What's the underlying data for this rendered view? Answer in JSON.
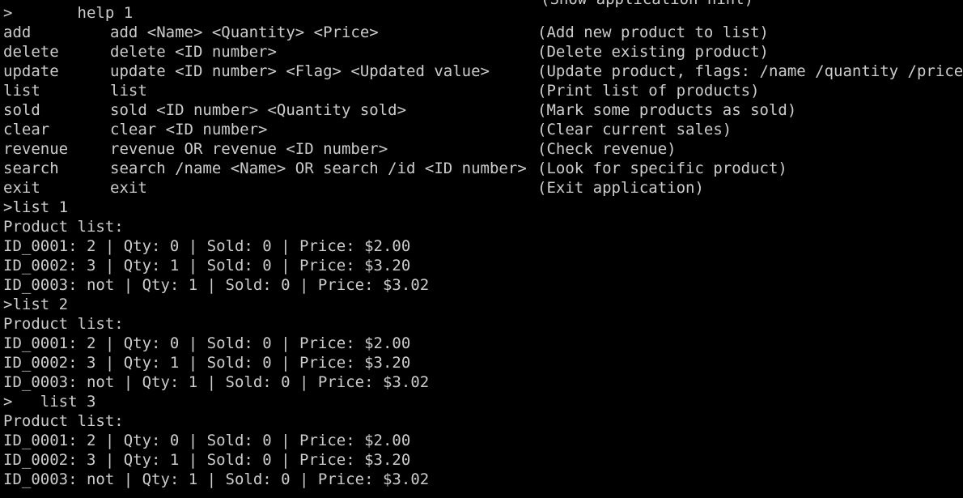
{
  "top_clipped_text": "(Show application hint)",
  "prompt_help": ">       help 1",
  "help_rows": [
    {
      "cmd": "add",
      "syntax": "add <Name> <Quantity> <Price>",
      "desc": "(Add new product to list)"
    },
    {
      "cmd": "delete",
      "syntax": "delete <ID number>",
      "desc": "(Delete existing product)"
    },
    {
      "cmd": "update",
      "syntax": "update <ID number> <Flag> <Updated value>",
      "desc": "(Update product, flags: /name /quantity /price)"
    },
    {
      "cmd": "list",
      "syntax": "list",
      "desc": "(Print list of products)"
    },
    {
      "cmd": "sold",
      "syntax": "sold <ID number> <Quantity sold>",
      "desc": "(Mark some products as sold)"
    },
    {
      "cmd": "clear",
      "syntax": "clear <ID number>",
      "desc": "(Clear current sales)"
    },
    {
      "cmd": "revenue",
      "syntax": "revenue OR revenue <ID number>",
      "desc": "(Check revenue)"
    },
    {
      "cmd": "search",
      "syntax": "search /name <Name> OR search /id <ID number>",
      "desc": "(Look for specific product)"
    },
    {
      "cmd": "exit",
      "syntax": "exit",
      "desc": "(Exit application)"
    }
  ],
  "list_blocks": [
    {
      "prompt": ">list 1",
      "header": "Product list:",
      "rows": [
        "ID_0001: 2 | Qty: 0 | Sold: 0 | Price: $2.00",
        "ID_0002: 3 | Qty: 1 | Sold: 0 | Price: $3.20",
        "ID_0003: not | Qty: 1 | Sold: 0 | Price: $3.02"
      ]
    },
    {
      "prompt": ">list 2",
      "header": "Product list:",
      "rows": [
        "ID_0001: 2 | Qty: 0 | Sold: 0 | Price: $2.00",
        "ID_0002: 3 | Qty: 1 | Sold: 0 | Price: $3.20",
        "ID_0003: not | Qty: 1 | Sold: 0 | Price: $3.02"
      ]
    },
    {
      "prompt": ">   list 3",
      "header": "Product list:",
      "rows": [
        "ID_0001: 2 | Qty: 0 | Sold: 0 | Price: $2.00",
        "ID_0002: 3 | Qty: 1 | Sold: 0 | Price: $3.20",
        "ID_0003: not | Qty: 1 | Sold: 0 | Price: $3.02"
      ]
    }
  ]
}
